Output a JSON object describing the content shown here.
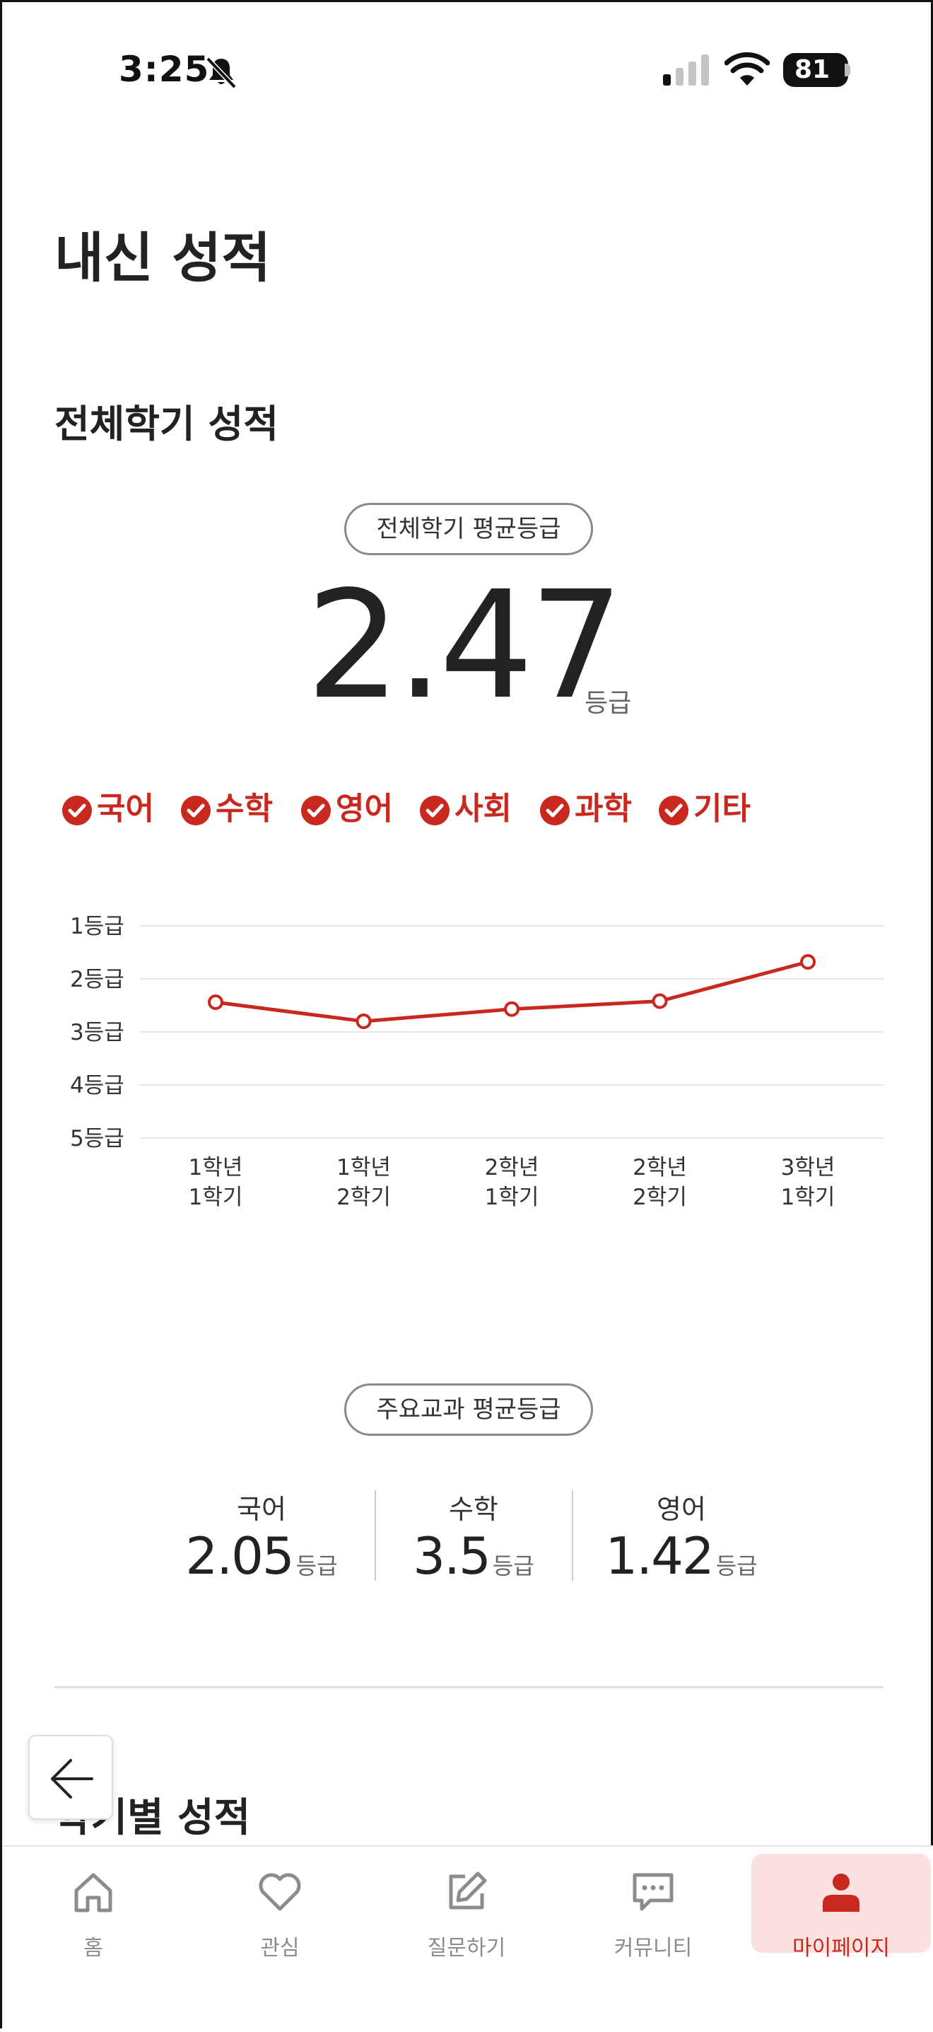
{
  "status_bar": {
    "time": "3:25",
    "battery": "81",
    "icons": [
      "bell-slash-icon",
      "signal-icon",
      "wifi-icon",
      "battery-icon"
    ]
  },
  "page": {
    "title": "내신 성적",
    "section_title": "전체학기 성적"
  },
  "overall": {
    "pill_label": "전체학기 평균등급",
    "grade": "2.47",
    "unit": "등급"
  },
  "filters": [
    {
      "label": "국어",
      "checked": true
    },
    {
      "label": "수학",
      "checked": true
    },
    {
      "label": "영어",
      "checked": true
    },
    {
      "label": "사회",
      "checked": true
    },
    {
      "label": "과학",
      "checked": true
    },
    {
      "label": "기타",
      "checked": true
    }
  ],
  "colors": {
    "accent": "#c8281e",
    "active_tab_bg": "#fbe1df",
    "text": "#222222",
    "muted": "#8c8c8c"
  },
  "chart_data": {
    "type": "line",
    "y_ticks": [
      "1등급",
      "2등급",
      "3등급",
      "4등급",
      "5등급"
    ],
    "ylim": [
      1,
      5
    ],
    "y_inverted": true,
    "categories": [
      [
        "1학년",
        "1학기"
      ],
      [
        "1학년",
        "2학기"
      ],
      [
        "2학년",
        "1학기"
      ],
      [
        "2학년",
        "2학기"
      ],
      [
        "3학년",
        "1학기"
      ]
    ],
    "values": [
      2.44,
      2.8,
      2.57,
      2.42,
      1.68
    ],
    "grid": true,
    "line_color": "#c8281e"
  },
  "major": {
    "pill_label": "주요교과 평균등급",
    "subjects": [
      {
        "name": "국어",
        "value": "2.05",
        "unit": "등급"
      },
      {
        "name": "수학",
        "value": "3.5",
        "unit": "등급"
      },
      {
        "name": "영어",
        "value": "1.42",
        "unit": "등급"
      }
    ]
  },
  "semester_section": {
    "title": "학기별 성적"
  },
  "tabbar": {
    "items": [
      {
        "label": "홈",
        "icon": "home-icon",
        "active": false
      },
      {
        "label": "관심",
        "icon": "heart-icon",
        "active": false
      },
      {
        "label": "질문하기",
        "icon": "edit-icon",
        "active": false
      },
      {
        "label": "커뮤니티",
        "icon": "chat-icon",
        "active": false
      },
      {
        "label": "마이페이지",
        "icon": "person-icon",
        "active": true
      }
    ]
  }
}
